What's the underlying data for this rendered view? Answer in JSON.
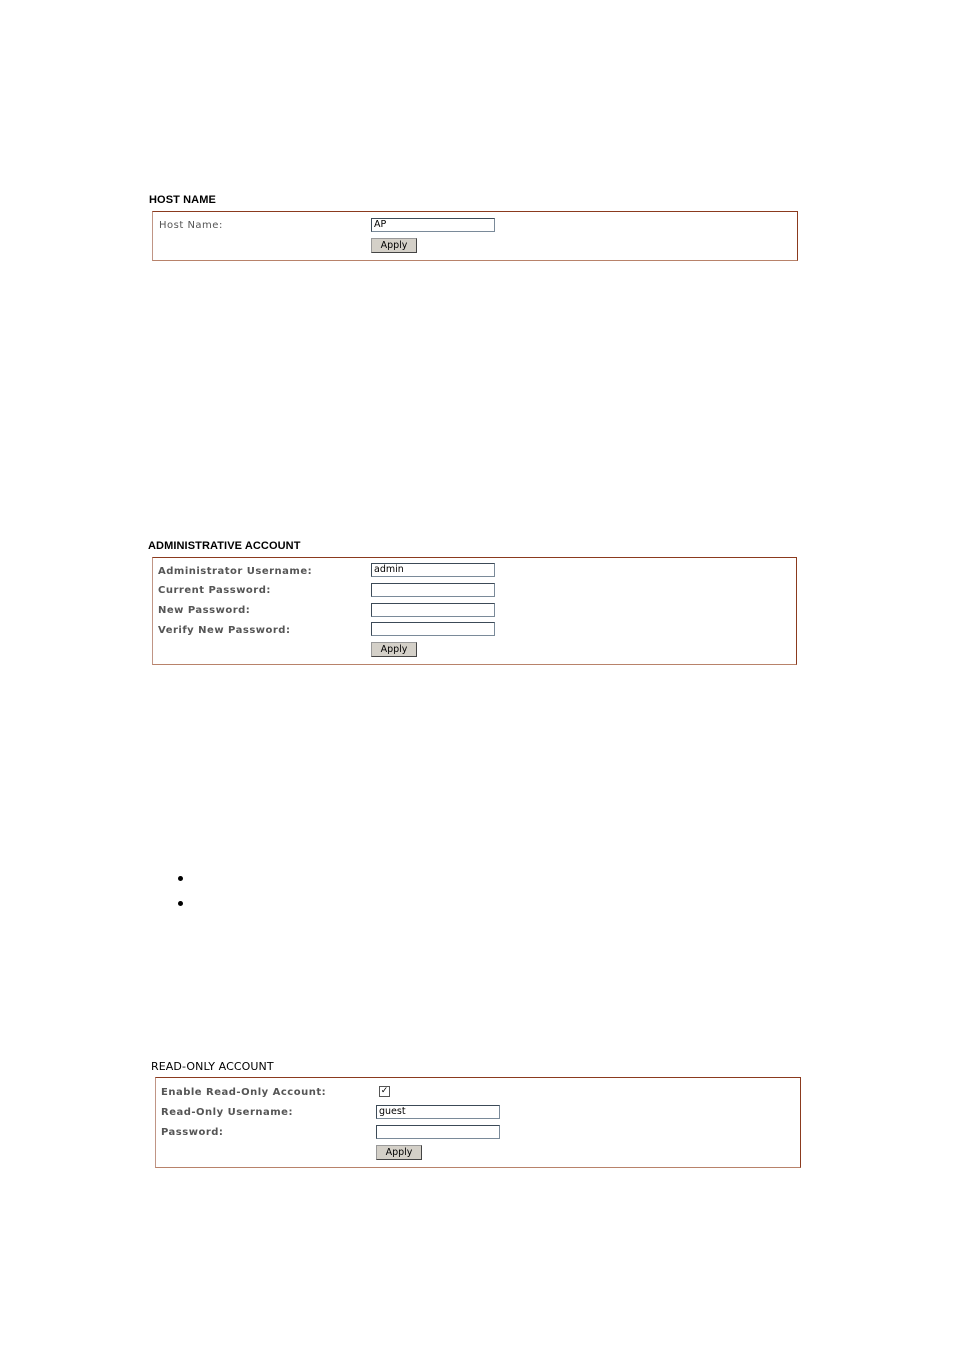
{
  "host_name_section": {
    "title": "HOST NAME",
    "fields": [
      {
        "label": "Host Name:",
        "value": "AP"
      }
    ],
    "apply_label": "Apply"
  },
  "admin_section": {
    "title": "ADMINISTRATIVE ACCOUNT",
    "fields": [
      {
        "label": "Administrator Username:",
        "value": "admin"
      },
      {
        "label": "Current Password:",
        "value": ""
      },
      {
        "label": "New Password:",
        "value": ""
      },
      {
        "label": "Verify New Password:",
        "value": ""
      }
    ],
    "apply_label": "Apply"
  },
  "bullets": [
    "",
    ""
  ],
  "readonly_section": {
    "title": "READ-ONLY ACCOUNT",
    "enable_label": "Enable Read-Only Account:",
    "enable_checked": true,
    "check_glyph": "✓",
    "fields": [
      {
        "label": "Read-Only Username:",
        "value": "guest"
      },
      {
        "label": "Password:",
        "value": ""
      }
    ],
    "apply_label": "Apply"
  }
}
